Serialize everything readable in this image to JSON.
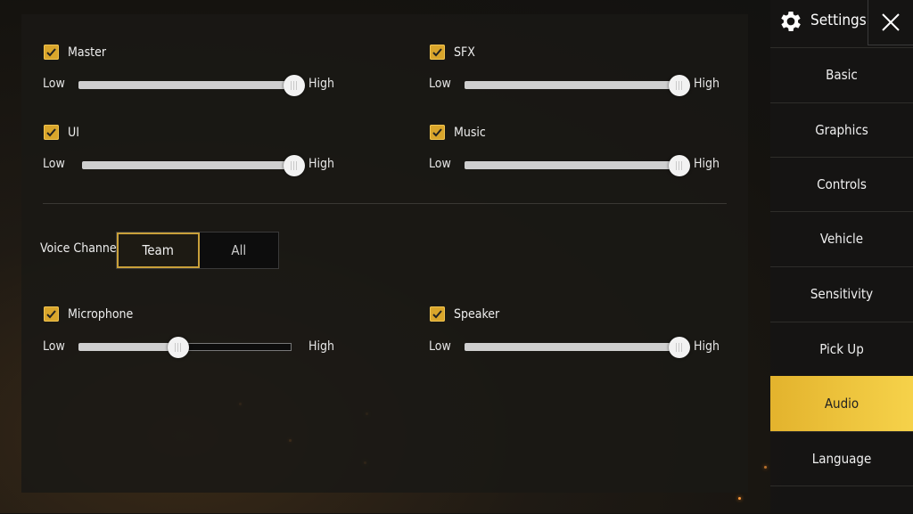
{
  "sliders": [
    {
      "id": "master",
      "label": "Master",
      "checked": true,
      "low": "Low",
      "high": "High",
      "value": 1.0
    },
    {
      "id": "sfx",
      "label": "SFX",
      "checked": true,
      "low": "Low",
      "high": "High",
      "value": 1.0
    },
    {
      "id": "ui",
      "label": "UI",
      "checked": true,
      "low": "Low",
      "high": "High",
      "value": 1.0
    },
    {
      "id": "music",
      "label": "Music",
      "checked": true,
      "low": "Low",
      "high": "High",
      "value": 1.0
    },
    {
      "id": "microphone",
      "label": "Microphone",
      "checked": true,
      "low": "Low",
      "high": "High",
      "value": 0.47
    },
    {
      "id": "speaker",
      "label": "Speaker",
      "checked": true,
      "low": "Low",
      "high": "High",
      "value": 1.0
    }
  ],
  "voice": {
    "label": "Voice Channel",
    "options": [
      "Team",
      "All"
    ],
    "selected": "Team"
  },
  "sidebar": {
    "title": "Settings",
    "items": [
      "Basic",
      "Graphics",
      "Controls",
      "Vehicle",
      "Sensitivity",
      "Pick Up",
      "Audio",
      "Language"
    ],
    "active": "Audio"
  },
  "colors": {
    "accent": "#e3b32d",
    "checkbox": "#d9a52b"
  }
}
